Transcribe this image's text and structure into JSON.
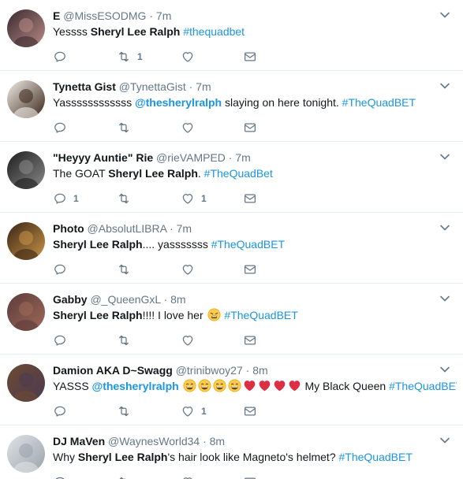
{
  "tweets": [
    {
      "name": "E",
      "handle": "@MissESODMG",
      "time": "7m",
      "text": [
        {
          "t": "Yessss "
        },
        {
          "b": "Sheryl Lee Ralph"
        },
        {
          "t": " "
        },
        {
          "h": "#thequadbet"
        }
      ],
      "counts": {
        "reply": "",
        "retweet": "1",
        "like": ""
      },
      "avatar_colors": [
        "#3a2a2e",
        "#b88a86"
      ]
    },
    {
      "name": "Tynetta Gist",
      "handle": "@TynettaGist",
      "time": "7m",
      "text": [
        {
          "t": "Yassssssssssss "
        },
        {
          "m": "@thesherylralph"
        },
        {
          "t": " slaying on here tonight. "
        },
        {
          "h": "#TheQuadBET"
        }
      ],
      "counts": {
        "reply": "",
        "retweet": "",
        "like": ""
      },
      "avatar_colors": [
        "#f2efe9",
        "#3a2418"
      ]
    },
    {
      "name": "\"Heyyy Auntie\" Rie",
      "handle": "@rieVAMPED",
      "time": "7m",
      "text": [
        {
          "t": "The GOAT "
        },
        {
          "b": "Sheryl Lee Ralph"
        },
        {
          "t": ". "
        },
        {
          "h": "#TheQuadBet"
        }
      ],
      "counts": {
        "reply": "1",
        "retweet": "",
        "like": "1"
      },
      "avatar_colors": [
        "#1d1d1d",
        "#8a8a8a"
      ]
    },
    {
      "name": "Photo",
      "handle": "@AbsolutLIBRA",
      "time": "7m",
      "text": [
        {
          "b": "Sheryl Lee Ralph"
        },
        {
          "t": ".... yasssssss "
        },
        {
          "h": "#TheQuadBET"
        }
      ],
      "counts": {
        "reply": "",
        "retweet": "",
        "like": ""
      },
      "avatar_colors": [
        "#3b2416",
        "#c89448"
      ]
    },
    {
      "name": "Gabby",
      "handle": "@_QueenGxL",
      "time": "8m",
      "text": [
        {
          "b": "Sheryl Lee Ralph"
        },
        {
          "t": "!!!! I love her "
        },
        {
          "e": "tired-face-emoji"
        },
        {
          "t": " "
        },
        {
          "h": "#TheQuadBET"
        }
      ],
      "counts": {
        "reply": "",
        "retweet": "",
        "like": ""
      },
      "avatar_colors": [
        "#5b3a3a",
        "#a06a5a"
      ]
    },
    {
      "name": "Damion AKA D~Swagg",
      "handle": "@trinibwoy27",
      "time": "8m",
      "text": [
        {
          "t": "YASSS "
        },
        {
          "m": "@thesherylralph"
        },
        {
          "t": " "
        },
        {
          "e": "grin-emoji"
        },
        {
          "e": "grin-emoji"
        },
        {
          "e": "grin-emoji"
        },
        {
          "e": "grin-emoji"
        },
        {
          "e": "heart-emoji"
        },
        {
          "e": "heart-emoji"
        },
        {
          "e": "heart-emoji"
        },
        {
          "e": "heart-emoji"
        },
        {
          "t": " My Black Queen "
        },
        {
          "h": "#TheQuadBET"
        }
      ],
      "counts": {
        "reply": "",
        "retweet": "",
        "like": "1"
      },
      "avatar_colors": [
        "#6e4a32",
        "#4a3a52"
      ]
    },
    {
      "name": "DJ MaVen",
      "handle": "@WaynesWorld34",
      "time": "8m",
      "text": [
        {
          "t": "Why "
        },
        {
          "b": "Sheryl Lee Ralph"
        },
        {
          "t": "'s hair look like Magneto's helmet? "
        },
        {
          "h": "#TheQuadBET"
        }
      ],
      "counts": {
        "reply": "",
        "retweet": "",
        "like": ""
      },
      "avatar_colors": [
        "#dfe3e6",
        "#9aa3ab"
      ]
    }
  ],
  "icons": {
    "reply": "reply-icon",
    "retweet": "retweet-icon",
    "like": "heart-outline-icon",
    "dm": "envelope-icon",
    "menu": "chevron-down-icon"
  },
  "colors": {
    "hashtag": "#1b95e0",
    "meta": "#657786",
    "text": "#14171a",
    "divider": "#e6ecf0"
  }
}
